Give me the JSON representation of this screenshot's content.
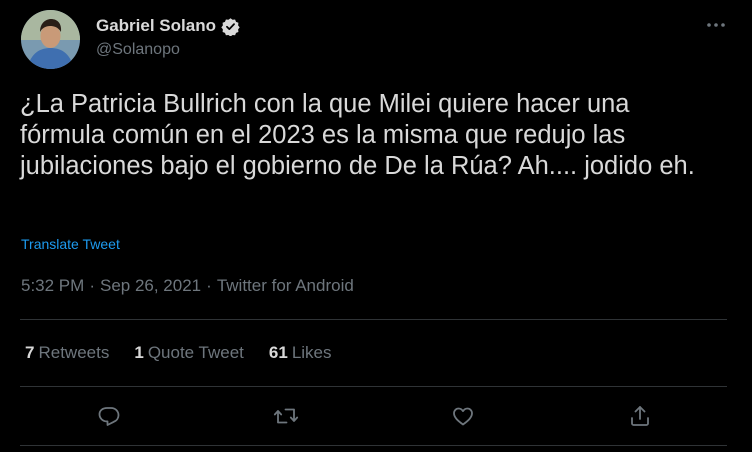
{
  "author": {
    "display_name": "Gabriel Solano",
    "handle": "@Solanopo",
    "verified": true
  },
  "tweet": {
    "text": "¿La Patricia Bullrich con la que Milei quiere hacer una fórmula común en el 2023 es la misma que redujo las jubilaciones bajo el gobierno de De la Rúa? Ah.... jodido eh.",
    "translate_label": "Translate Tweet",
    "time": "5:32 PM",
    "separator": "·",
    "date": "Sep 26, 2021",
    "source": "Twitter for Android"
  },
  "stats": {
    "retweets_count": "7",
    "retweets_label": "Retweets",
    "quotes_count": "1",
    "quotes_label": "Quote Tweet",
    "likes_count": "61",
    "likes_label": "Likes"
  },
  "actions": {
    "icons": [
      "reply-icon",
      "retweet-icon",
      "like-icon",
      "share-icon"
    ]
  },
  "colors": {
    "background": "#000000",
    "text": "#d9d9d9",
    "secondary": "#6e767d",
    "link": "#1d9bf0",
    "divider": "#2f3336"
  }
}
